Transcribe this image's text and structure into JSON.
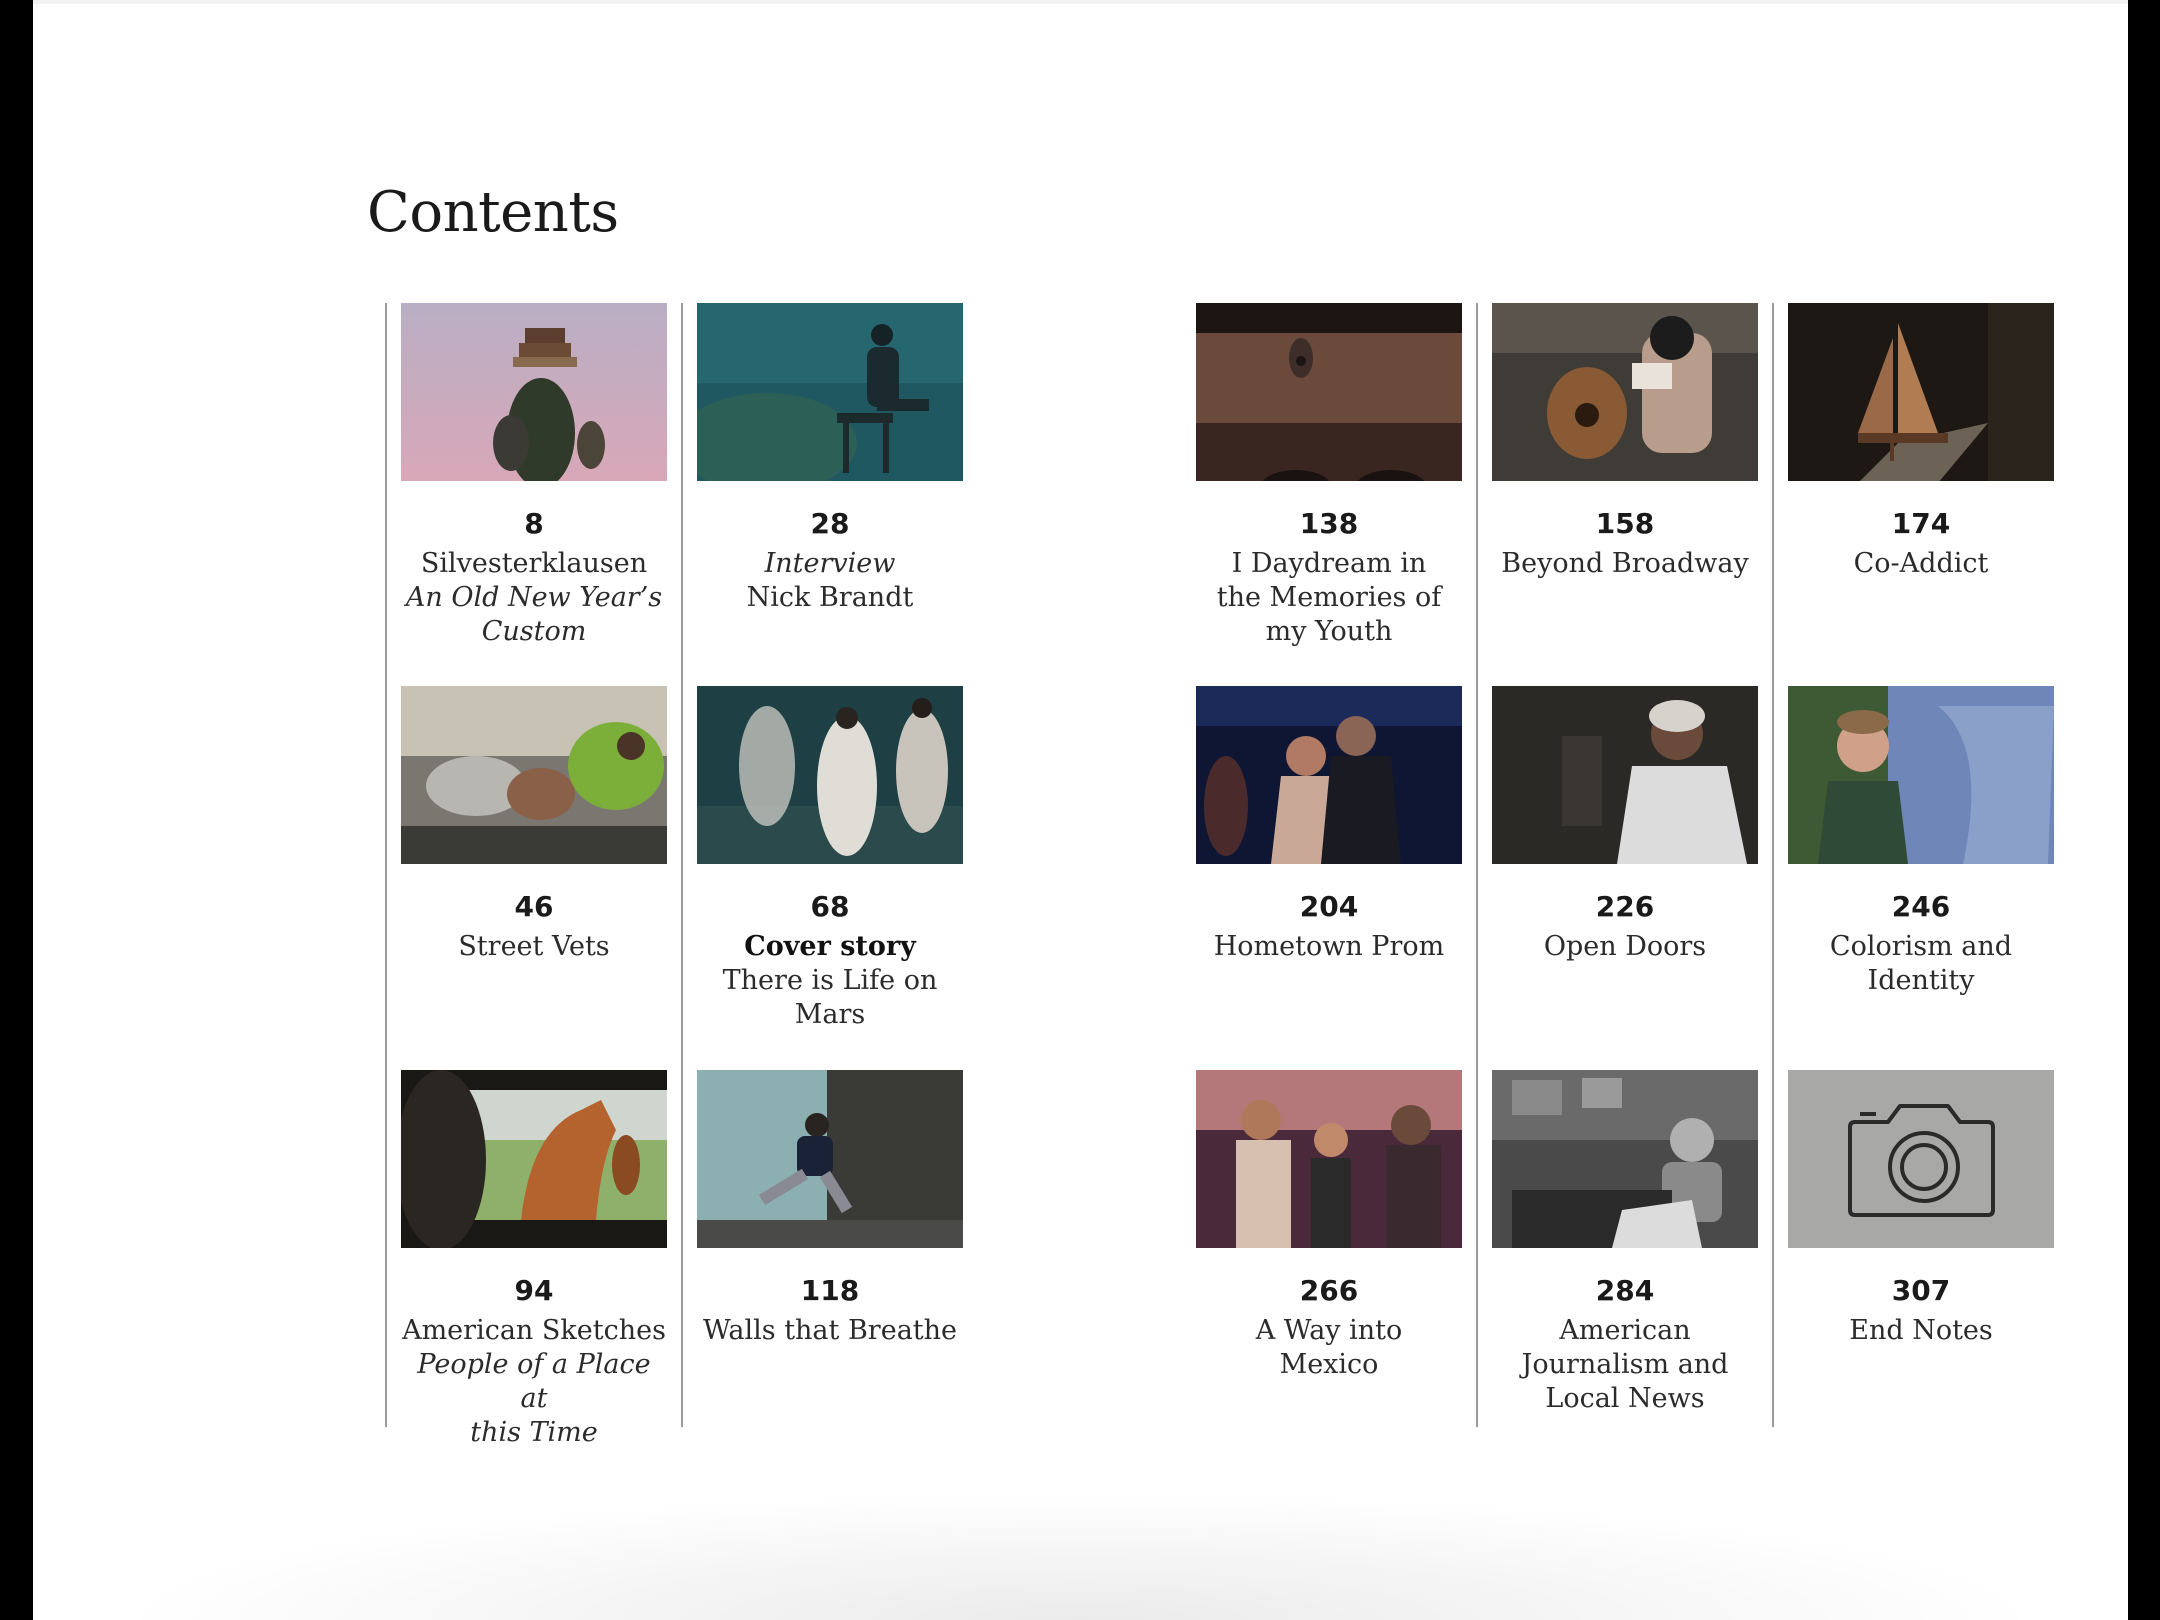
{
  "page": {
    "title": "Contents"
  },
  "entries": [
    {
      "page": "8",
      "lines": [
        {
          "text": "Silvesterklausen",
          "style": "normal"
        },
        {
          "text": "An Old New Year’s",
          "style": "italic"
        },
        {
          "text": "Custom",
          "style": "italic"
        }
      ],
      "icon": "silvesterklausen-photo"
    },
    {
      "page": "28",
      "lines": [
        {
          "text": "Interview",
          "style": "italic"
        },
        {
          "text": "Nick Brandt",
          "style": "normal"
        }
      ],
      "icon": "underwater-man-photo"
    },
    {
      "page": "138",
      "lines": [
        {
          "text": "I Daydream in",
          "style": "normal"
        },
        {
          "text": "the Memories of",
          "style": "normal"
        },
        {
          "text": "my Youth",
          "style": "normal"
        }
      ],
      "icon": "eye-tattoo-photo"
    },
    {
      "page": "158",
      "lines": [
        {
          "text": "Beyond Broadway",
          "style": "normal"
        }
      ],
      "icon": "guitar-man-photo"
    },
    {
      "page": "174",
      "lines": [
        {
          "text": "Co-Addict",
          "style": "normal"
        }
      ],
      "icon": "model-sailboat-photo"
    },
    {
      "page": "46",
      "lines": [
        {
          "text": "Street Vets",
          "style": "normal"
        }
      ],
      "icon": "dogs-in-coats-photo"
    },
    {
      "page": "68",
      "lines": [
        {
          "text": "Cover story",
          "style": "bold"
        },
        {
          "text": "There is Life on",
          "style": "normal"
        },
        {
          "text": "Mars",
          "style": "normal"
        }
      ],
      "icon": "white-robed-dancers-photo"
    },
    {
      "page": "204",
      "lines": [
        {
          "text": "Hometown Prom",
          "style": "normal"
        }
      ],
      "icon": "prom-dancers-photo"
    },
    {
      "page": "226",
      "lines": [
        {
          "text": "Open Doors",
          "style": "normal"
        }
      ],
      "icon": "elderly-woman-photo"
    },
    {
      "page": "246",
      "lines": [
        {
          "text": "Colorism and",
          "style": "normal"
        },
        {
          "text": "Identity",
          "style": "normal"
        }
      ],
      "icon": "boy-hugging-mother-photo"
    },
    {
      "page": "94",
      "lines": [
        {
          "text": "American Sketches",
          "style": "normal"
        },
        {
          "text": "People of a Place at",
          "style": "italic"
        },
        {
          "text": "this Time",
          "style": "italic"
        }
      ],
      "icon": "horse-through-car-window-photo"
    },
    {
      "page": "118",
      "lines": [
        {
          "text": "Walls that Breathe",
          "style": "normal"
        }
      ],
      "icon": "leaping-boy-photo"
    },
    {
      "page": "266",
      "lines": [
        {
          "text": "A Way into",
          "style": "normal"
        },
        {
          "text": "Mexico",
          "style": "normal"
        }
      ],
      "icon": "family-on-bus-photo"
    },
    {
      "page": "284",
      "lines": [
        {
          "text": "American",
          "style": "normal"
        },
        {
          "text": "Journalism and",
          "style": "normal"
        },
        {
          "text": "Local News",
          "style": "normal"
        }
      ],
      "icon": "newspaper-editor-photo"
    },
    {
      "page": "307",
      "lines": [
        {
          "text": "End Notes",
          "style": "normal"
        }
      ],
      "icon": "camera-icon"
    }
  ],
  "colors": {
    "page_background": "#ffffff",
    "bezel": "#000000",
    "divider": "#9a9a9a",
    "text": "#2b2b2b",
    "camera_tile": "#a8a8a6"
  }
}
